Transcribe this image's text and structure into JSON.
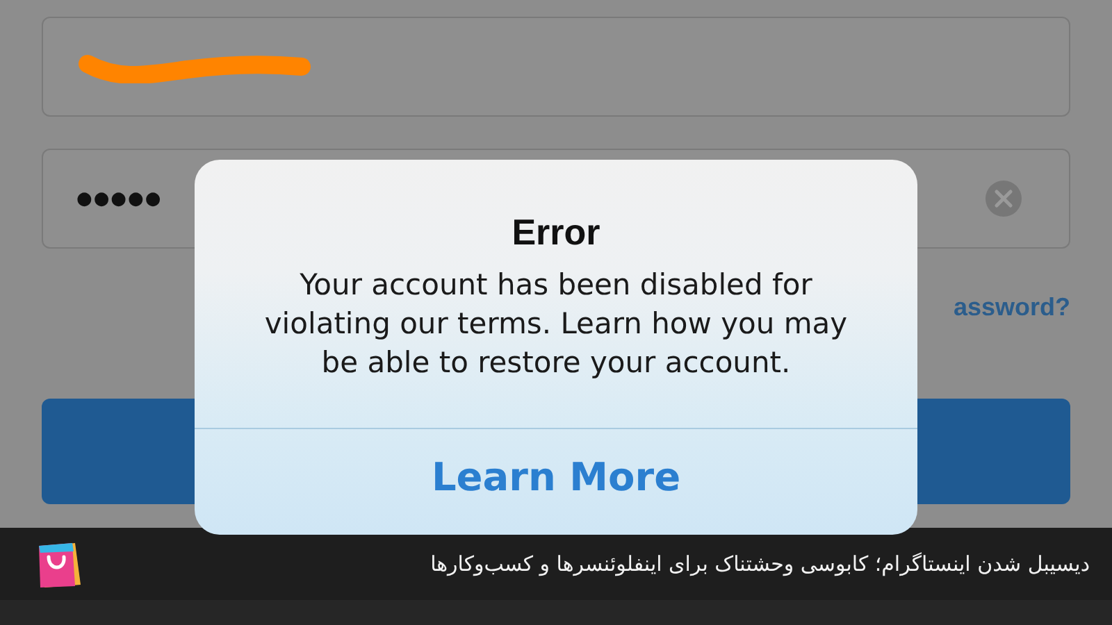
{
  "login_form": {
    "username_field": {
      "redacted": true
    },
    "password_field": {
      "value": "●●●●●",
      "clear_button": true
    },
    "forgot_link": "assword?"
  },
  "alert": {
    "title": "Error",
    "message": "Your account has been disabled for violating our terms. Learn how you may be able to restore your account.",
    "buttons": [
      "Learn More"
    ]
  },
  "caption": {
    "text": "دیسیبل شدن اینستاگرام؛ کابوسی وحشتناک برای اینفلوئنسرها و کسب‌وکارها"
  }
}
